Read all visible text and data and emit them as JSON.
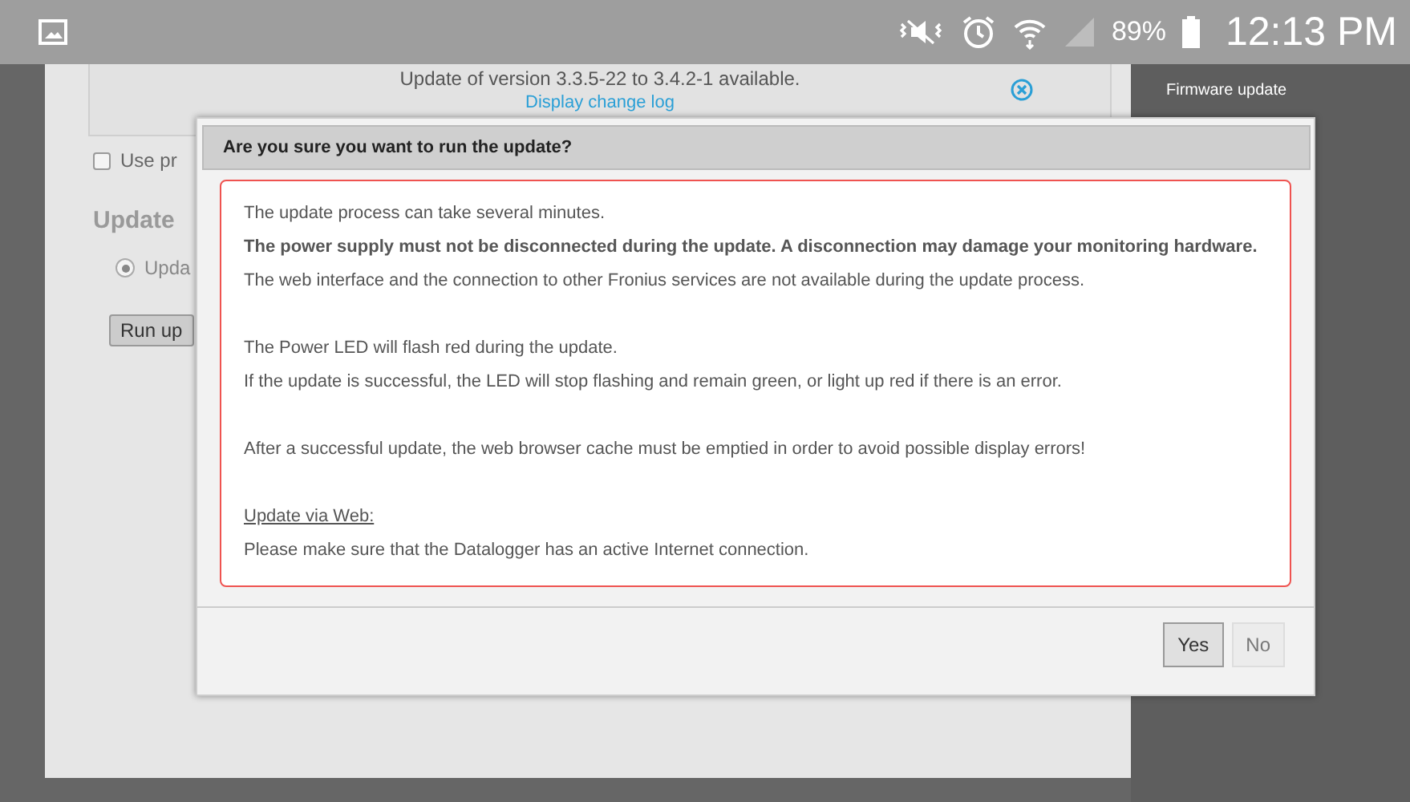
{
  "status_bar": {
    "battery": "89%",
    "time": "12:13 PM"
  },
  "page": {
    "notice": {
      "text": "Update of version 3.3.5-22 to 3.4.2-1 available.",
      "link": "Display change log"
    },
    "checkboxes": [
      {
        "label": "Use pr",
        "checked": false
      }
    ],
    "section_title": "Update",
    "radios": [
      {
        "label": "Upda",
        "selected": true
      }
    ],
    "button": "Run up"
  },
  "sidebar": {
    "items": [
      {
        "label": "Firmware update"
      }
    ]
  },
  "dialog": {
    "title": "Are you sure you want to run the update?",
    "groups": [
      [
        {
          "kind": "plain",
          "text": "The update process can take several minutes."
        },
        {
          "kind": "bold",
          "text": "The power supply must not be disconnected during the update. A disconnection may damage your monitoring hardware."
        },
        {
          "kind": "plain",
          "text": "The web interface and the connection to other Fronius services are not available during the update process."
        }
      ],
      [
        {
          "kind": "plain",
          "text": "The Power LED will flash red during the update."
        },
        {
          "kind": "plain",
          "text": "If the update is successful, the LED will stop flashing and remain green, or light up red if there is an error."
        }
      ],
      [
        {
          "kind": "plain",
          "text": "After a successful update, the web browser cache must be emptied in order to avoid possible display errors!"
        }
      ],
      [
        {
          "kind": "heading",
          "text": "Update via Web:"
        },
        {
          "kind": "plain",
          "text": "Please make sure that the Datalogger has an active Internet connection."
        }
      ]
    ],
    "buttons": [
      {
        "label": "Yes",
        "focused": true
      },
      {
        "label": "No",
        "focused": false
      }
    ]
  }
}
